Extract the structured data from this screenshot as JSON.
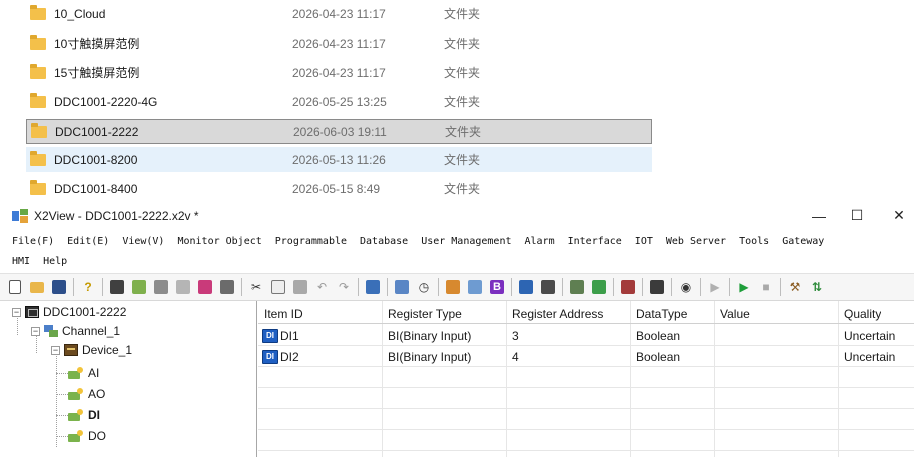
{
  "explorer": {
    "files": [
      {
        "name": "10_Cloud",
        "date": "2026-04-23 11:17",
        "type": "文件夹"
      },
      {
        "name": "10寸触摸屏范例",
        "date": "2026-04-23 11:17",
        "type": "文件夹"
      },
      {
        "name": "15寸触摸屏范例",
        "date": "2026-04-23 11:17",
        "type": "文件夹"
      },
      {
        "name": "DDC1001-2220-4G",
        "date": "2026-05-25 13:25",
        "type": "文件夹"
      },
      {
        "name": "DDC1001-2222",
        "date": "2026-06-03 19:11",
        "type": "文件夹"
      },
      {
        "name": "DDC1001-8200",
        "date": "2026-05-13 11:26",
        "type": "文件夹"
      },
      {
        "name": "DDC1001-8400",
        "date": "2026-05-15 8:49",
        "type": "文件夹"
      }
    ],
    "selected_index": 4,
    "hover_index": 5,
    "folder_color": "#f4c04a"
  },
  "app": {
    "title": "X2View - DDC1001-2222.x2v *",
    "window_controls": {
      "minimize": "—",
      "maximize": "☐",
      "close": "✕"
    },
    "menu": [
      "File(F)",
      "Edit(E)",
      "View(V)",
      "Monitor Object",
      "Programmable",
      "Database",
      "User Management",
      "Alarm",
      "Interface",
      "IOT",
      "Web Server",
      "Tools",
      "Gateway",
      "HMI",
      "Help"
    ],
    "toolbar": [
      "new-file-icon",
      "open-folder-icon",
      "save-icon",
      "help-icon",
      "grid-icon",
      "tag-add-icon",
      "table-icon",
      "properties-icon",
      "device-icon",
      "settings-icon",
      "cut-icon",
      "copy-icon",
      "paste-icon",
      "undo-icon",
      "redo-icon",
      "monitor-icon",
      "list-icon",
      "clock-icon",
      "script-icon",
      "database-icon",
      "bold-b-icon",
      "chart-icon",
      "window-icon",
      "users-icon",
      "alarm-icon",
      "bug-icon",
      "compile-icon",
      "view-icon",
      "play-outline-icon",
      "run-icon",
      "stop-icon",
      "tools-icon",
      "transfer-icon"
    ]
  },
  "tree": {
    "root": "DDC1001-2222",
    "channel": "Channel_1",
    "device": "Device_1",
    "tags": [
      "AI",
      "AO",
      "DI",
      "DO"
    ],
    "selected_tag": "DI"
  },
  "grid": {
    "columns": [
      "Item ID",
      "Register Type",
      "Register Address",
      "DataType",
      "Value",
      "Quality"
    ],
    "rows": [
      [
        "DI1",
        "BI(Binary Input)",
        "3",
        "Boolean",
        "",
        "Uncertain"
      ],
      [
        "DI2",
        "BI(Binary Input)",
        "4",
        "Boolean",
        "",
        "Uncertain"
      ]
    ],
    "item_icon_label": "DI"
  },
  "colors": {
    "selection": "#d9d9d9",
    "hover": "#e5f1fb",
    "run_green": "#1e9e3a",
    "bold_b_purple": "#7b2fbf",
    "di_icon_blue": "#1f5fc2"
  }
}
